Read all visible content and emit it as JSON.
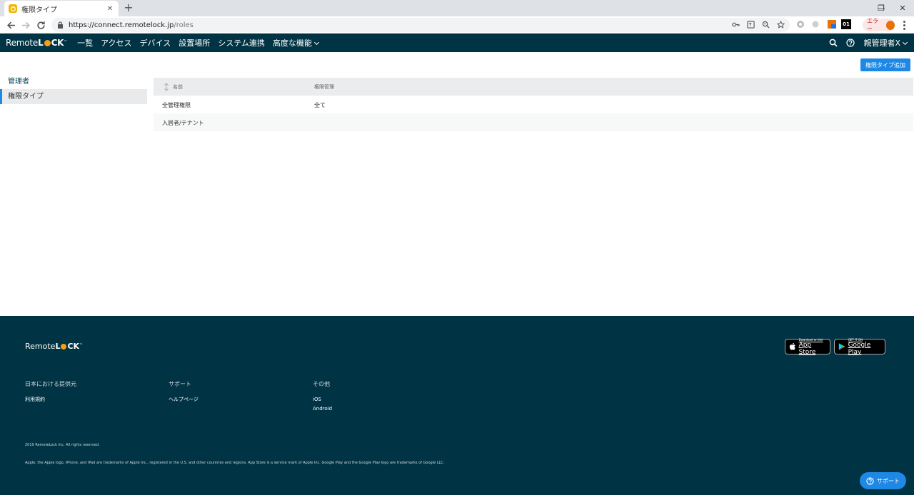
{
  "browser": {
    "tab_title": "権限タイプ",
    "tab_close": "✕",
    "new_tab": "+",
    "url_host": "https://connect.remotelock.jp",
    "url_path": "/roles",
    "ext_badge": "01",
    "error_label": "エラー",
    "window_minimize": "—",
    "window_restore": "❐",
    "window_close": "✕"
  },
  "header": {
    "logo_text": "Remote",
    "logo_bold_l": "L",
    "logo_bold_ck": "CK",
    "logo_tm": "™",
    "nav": [
      "一覧",
      "アクセス",
      "デバイス",
      "設置場所",
      "システム連携",
      "高度な機能"
    ],
    "user": "親管理者X"
  },
  "sidebar": {
    "heading": "管理者",
    "items": [
      {
        "label": "権限タイプ"
      }
    ]
  },
  "main": {
    "add_button": "権限タイプ追加",
    "table": {
      "columns": [
        "名前",
        "権限管理"
      ],
      "rows": [
        [
          "全管理権限",
          "全て"
        ],
        [
          "入居者/テナント",
          ""
        ]
      ]
    }
  },
  "footer": {
    "logo_text": "Remote",
    "logo_bold_l": "L",
    "logo_bold_ck": "CK",
    "logo_tm": "™",
    "appstore_small": "Download on the",
    "appstore_big": "App Store",
    "googleplay_small": "GET IT ON",
    "googleplay_big": "Google Play",
    "columns": [
      {
        "heading": "日本における提供元",
        "links": [
          "利用規約"
        ]
      },
      {
        "heading": "サポート",
        "links": [
          "ヘルプページ"
        ]
      },
      {
        "heading": "その他",
        "links": [
          "iOS",
          "Android"
        ]
      }
    ],
    "copyright": "2019 RemoteLock Inc. All rights reserved.",
    "legal": "Apple, the Apple logo, iPhone, and iPad are trademarks of Apple Inc., registered in the U.S. and other countries and regions. App Store is a service mark of Apple Inc. Google Play and the Google Play logo are trademarks of Google LLC.",
    "support_button": "サポート"
  },
  "colors": {
    "nav_bg": "#003343",
    "accent": "#1e88e5",
    "logo_orange": "#f6a01a"
  }
}
